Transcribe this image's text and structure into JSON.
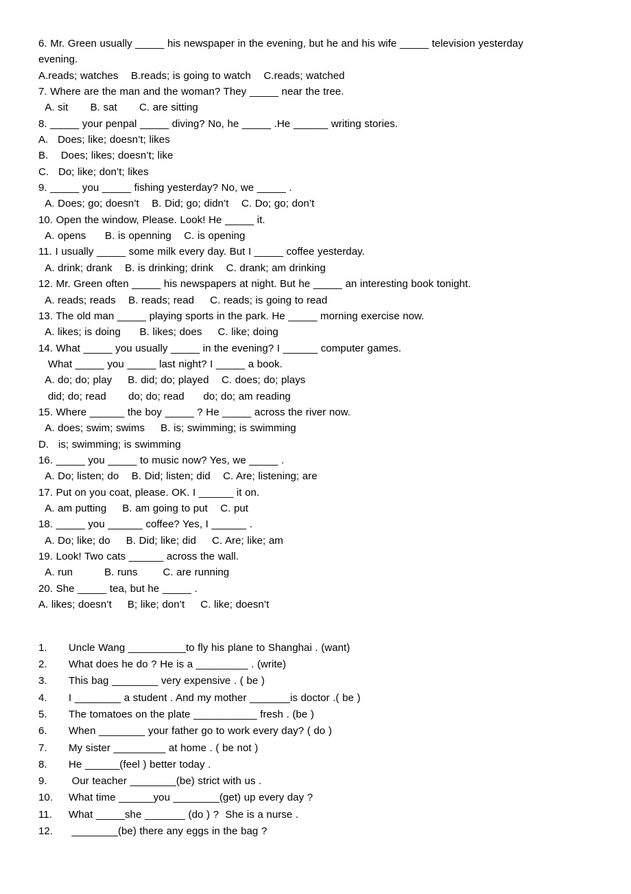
{
  "document": {
    "background_color": "#ffffff",
    "text_color": "#000000",
    "multiple_choice": {
      "lines": [
        "6. Mr. Green usually _____ his newspaper in the evening, but he and his wife _____ television yesterday",
        "evening.",
        "A.reads; watches    B.reads; is going to watch    C.reads; watched",
        "7. Where are the man and the woman? They _____ near the tree.",
        "  A. sit       B. sat       C. are sitting",
        "8. _____ your penpal _____ diving? No, he _____ .He ______ writing stories.",
        "A.   Does; like; doesn’t; likes",
        "B.    Does; likes; doesn’t; like",
        "C.   Do; like; don’t; likes",
        "9. _____ you _____ fishing yesterday? No, we _____ .",
        "  A. Does; go; doesn’t    B. Did; go; didn’t    C. Do; go; don’t",
        "10. Open the window, Please. Look! He _____ it.",
        "  A. opens      B. is openning    C. is opening",
        "11. I usually _____ some milk every day. But I _____ coffee yesterday.",
        "  A. drink; drank    B. is drinking; drink    C. drank; am drinking",
        "12. Mr. Green often _____ his newspapers at night. But he _____ an interesting book tonight.",
        "  A. reads; reads    B. reads; read     C. reads; is going to read",
        "13. The old man _____ playing sports in the park. He _____ morning exercise now.",
        "  A. likes; is doing      B. likes; does     C. like; doing",
        "14. What _____ you usually _____ in the evening? I ______ computer games.",
        "   What _____ you _____ last night? I _____ a book.",
        "  A. do; do; play     B. did; do; played    C. does; do; plays",
        "   did; do; read       do; do; read      do; do; am reading",
        "15. Where ______ the boy _____ ? He _____ across the river now.",
        "  A. does; swim; swims     B. is; swimming; is swimming",
        "D.   is; swimming; is swimming",
        "16. _____ you _____ to music now? Yes, we _____ .",
        "  A. Do; listen; do    B. Did; listen; did    C. Are; listening; are",
        "17. Put on you coat, please. OK. I ______ it on.",
        "  A. am putting     B. am going to put    C. put",
        "18. _____ you ______ coffee? Yes, I ______ .",
        "  A. Do; like; do     B. Did; like; did     C. Are; like; am",
        "19. Look! Two cats ______ across the wall.",
        "  A. run          B. runs        C. are running",
        "20. She _____ tea, but he _____ .",
        "A. likes; doesn’t     B; like; don’t     C. like; doesn’t"
      ]
    },
    "numbered_exercises": {
      "items": [
        {
          "number": "1.",
          "text": "Uncle Wang __________to fly his plane to Shanghai . (want)"
        },
        {
          "number": "2.",
          "text": "What does he do ? He is a _________ . (write)"
        },
        {
          "number": "3.",
          "text": "This bag ________ very expensive . ( be )"
        },
        {
          "number": "4.",
          "text": "I ________ a student . And my mother _______is doctor .( be )"
        },
        {
          "number": "5.",
          "text": "The tomatoes on the plate ___________ fresh . (be )"
        },
        {
          "number": "6.",
          "text": "When ________ your father go to work every day? ( do )"
        },
        {
          "number": "7.",
          "text": "My sister _________ at home . ( be not )"
        },
        {
          "number": "8.",
          "text": "He ______(feel ) better today ."
        },
        {
          "number": "9.",
          "text": " Our teacher ________(be) strict with us ."
        },
        {
          "number": "10.",
          "text": "What time ______you ________(get) up every day ?"
        },
        {
          "number": "11.",
          "text": "What _____she _______ (do ) ?  She is a nurse ."
        },
        {
          "number": "12.",
          "text": " ________(be) there any eggs in the bag ?"
        }
      ]
    }
  }
}
